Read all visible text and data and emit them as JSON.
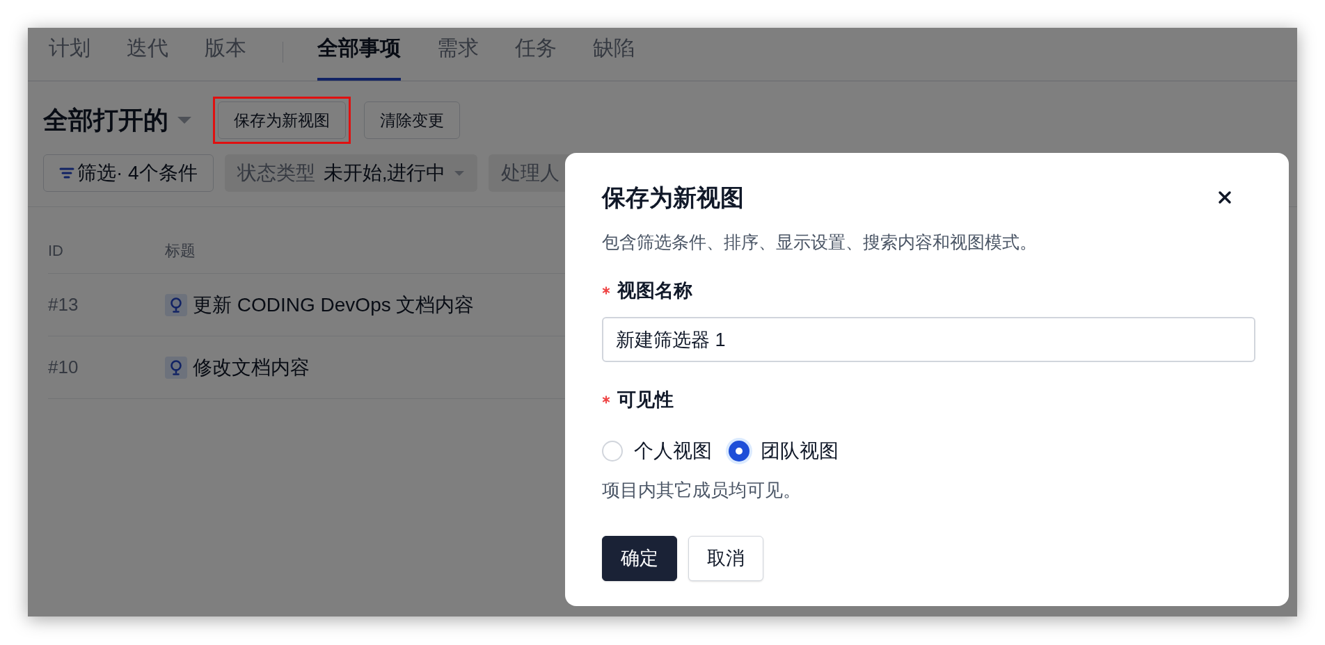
{
  "tab_groups": [
    {
      "tabs": [
        {
          "label": "计划",
          "selected": false
        },
        {
          "label": "迭代",
          "selected": false
        },
        {
          "label": "版本",
          "selected": false
        }
      ]
    },
    {
      "tabs": [
        {
          "label": "全部事项",
          "selected": true
        },
        {
          "label": "需求",
          "selected": false
        },
        {
          "label": "任务",
          "selected": false
        },
        {
          "label": "缺陷",
          "selected": false
        }
      ]
    }
  ],
  "view": {
    "title": "全部打开的"
  },
  "toolbar_buttons": [
    {
      "label": "保存为新视图",
      "highlighted": true
    },
    {
      "label": "清除变更",
      "highlighted": false
    }
  ],
  "filter_button": {
    "label": "筛选· 4个条件"
  },
  "filters": [
    {
      "name": "状态类型",
      "value": "未开始,进行中"
    },
    {
      "name": "处理人"
    }
  ],
  "table": {
    "columns": [
      "ID",
      "标题"
    ],
    "rows": [
      {
        "id": "#13",
        "title": "更新 CODING DevOps 文档内容"
      },
      {
        "id": "#10",
        "title": "修改文档内容"
      }
    ]
  },
  "dialog": {
    "title": "保存为新视图",
    "description": "包含筛选条件、排序、显示设置、搜索内容和视图模式。",
    "fields": [
      {
        "kind": "text",
        "label": "视图名称",
        "required": true,
        "value": "新建筛选器 1"
      },
      {
        "kind": "radio",
        "label": "可见性",
        "required": true,
        "options": [
          {
            "label": "个人视图",
            "selected": false
          },
          {
            "label": "团队视图",
            "selected": true
          }
        ],
        "help": "项目内其它成员均可见。"
      }
    ],
    "buttons": [
      {
        "label": "确定",
        "kind": "primary"
      },
      {
        "label": "取消",
        "kind": "secondary"
      }
    ]
  }
}
